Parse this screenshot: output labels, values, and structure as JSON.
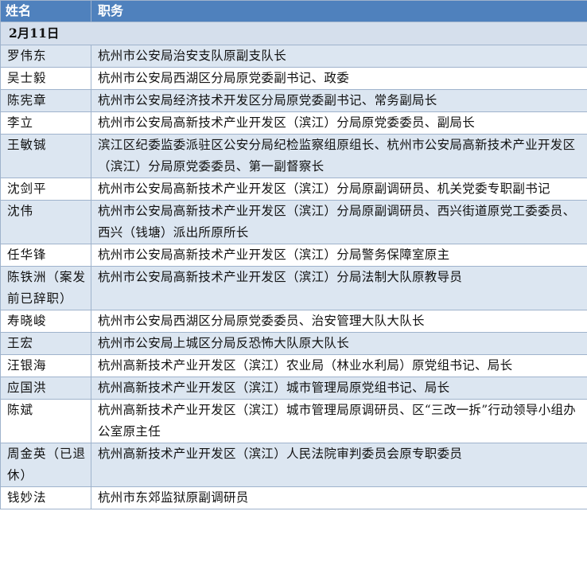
{
  "headers": {
    "name": "姓名",
    "duty": "职务"
  },
  "section": "2月11日",
  "rows": [
    {
      "name": "罗伟东",
      "duty": "杭州市公安局治安支队原副支队长"
    },
    {
      "name": "吴士毅",
      "duty": "杭州市公安局西湖区分局原党委副书记、政委"
    },
    {
      "name": "陈宪章",
      "duty": "杭州市公安局经济技术开发区分局原党委副书记、常务副局长"
    },
    {
      "name": "李立",
      "duty": "杭州市公安局高新技术产业开发区（滨江）分局原党委委员、副局长"
    },
    {
      "name": "王敏铖",
      "duty": "滨江区纪委监委派驻区公安分局纪检监察组原组长、杭州市公安局高新技术产业开发区（滨江）分局原党委委员、第一副督察长"
    },
    {
      "name": "沈剑平",
      "duty": "杭州市公安局高新技术产业开发区（滨江）分局原副调研员、机关党委专职副书记"
    },
    {
      "name": "沈伟",
      "duty": "杭州市公安局高新技术产业开发区（滨江）分局原副调研员、西兴街道原党工委委员、西兴（钱塘）派出所原所长"
    },
    {
      "name": "任华锋",
      "duty": "杭州市公安局高新技术产业开发区（滨江）分局警务保障室原主"
    },
    {
      "name": "陈铁洲（案发前已辞职）",
      "duty": "杭州市公安局高新技术产业开发区（滨江）分局法制大队原教导员"
    },
    {
      "name": "寿晓峻",
      "duty": "杭州市公安局西湖区分局原党委委员、治安管理大队大队长"
    },
    {
      "name": "王宏",
      "duty": "杭州市公安局上城区分局反恐怖大队原大队长"
    },
    {
      "name": "汪银海",
      "duty": "杭州高新技术产业开发区（滨江）农业局（林业水利局）原党组书记、局长"
    },
    {
      "name": "应国洪",
      "duty": "杭州高新技术产业开发区（滨江）城市管理局原党组书记、局长"
    },
    {
      "name": "陈斌",
      "duty": "杭州高新技术产业开发区（滨江）城市管理局原调研员、区“三改一拆”行动领导小组办公室原主任"
    },
    {
      "name": "周金英（已退休）",
      "duty": "杭州高新技术产业开发区（滨江）人民法院审判委员会原专职委员"
    },
    {
      "name": "钱妙法",
      "duty": "杭州市东郊监狱原副调研员"
    }
  ]
}
